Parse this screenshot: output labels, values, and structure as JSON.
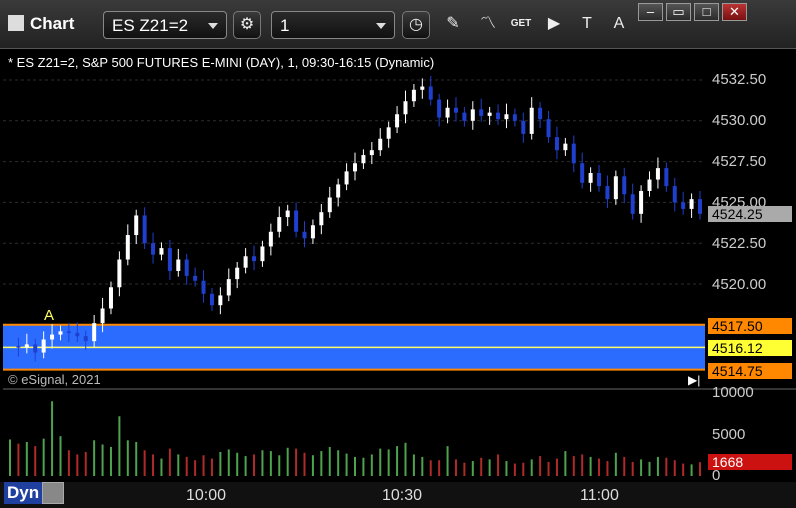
{
  "window": {
    "title": "Chart",
    "symbol_field": "ES Z21=2",
    "interval_field": "1",
    "buttons": [
      "settings-icon",
      "clock-icon",
      "pencil-icon",
      "study-icon",
      "get-icon",
      "play-icon",
      "text-tool-icon",
      "alert-icon"
    ],
    "get_label": "GET",
    "controls": [
      "minimize-icon",
      "restore-icon",
      "maximize-icon",
      "close-icon"
    ]
  },
  "chart": {
    "symbol_info": "* ES Z21=2, S&P 500 FUTURES E-MINI (DAY), 1, 09:30-16:15 (Dynamic)",
    "credit": "© eSignal, 2021",
    "marker_label": "A",
    "mode_label": "Dyn"
  },
  "colors": {
    "up": "#ffffff",
    "down": "#1f3fcf",
    "band": "#2b6cff",
    "band_edge": "#ff8800",
    "mid_line": "#ffff66",
    "vol_up": "#4ea34e",
    "vol_down": "#b02a2a"
  },
  "chart_data": {
    "type": "candlestick",
    "price_axis": {
      "ticks": [
        "4532.50",
        "4530.00",
        "4527.50",
        "4525.00",
        "4522.50",
        "4520.00"
      ]
    },
    "time_axis": {
      "ticks": [
        "10:00",
        "10:30",
        "11:00"
      ]
    },
    "volume_axis": {
      "ticks": [
        "10000",
        "5000",
        "0"
      ]
    },
    "price_tags": {
      "last": "4524.25",
      "band_top": "4517.50",
      "band_mid": "4516.12",
      "band_bottom": "4514.75",
      "volume_last": "1668"
    },
    "price_series": [
      4516.2,
      4516.1,
      4516.3,
      4515.8,
      4516.6,
      4516.9,
      4517.1,
      4517.0,
      4516.8,
      4516.5,
      4517.6,
      4518.5,
      4519.8,
      4521.5,
      4523.0,
      4524.2,
      4522.5,
      4521.8,
      4522.2,
      4520.8,
      4521.5,
      4520.5,
      4520.2,
      4519.4,
      4518.7,
      4519.3,
      4520.3,
      4521.0,
      4521.7,
      4521.4,
      4522.3,
      4523.2,
      4524.1,
      4524.5,
      4523.2,
      4522.8,
      4523.6,
      4524.4,
      4525.3,
      4526.1,
      4526.9,
      4527.4,
      4527.9,
      4528.2,
      4528.9,
      4529.6,
      4530.4,
      4531.2,
      4531.9,
      4532.1,
      4531.3,
      4530.2,
      4530.8,
      4530.5,
      4530.0,
      4530.7,
      4530.3,
      4530.5,
      4530.1,
      4530.4,
      4530.0,
      4529.2,
      4530.8,
      4530.1,
      4529.0,
      4528.2,
      4528.6,
      4527.4,
      4526.2,
      4526.8,
      4526.0,
      4525.2,
      4526.6,
      4525.5,
      4524.3,
      4525.7,
      4526.4,
      4527.1,
      4526.0,
      4525.0,
      4524.6,
      4525.2,
      4524.3
    ],
    "volume_series": [
      4400,
      3900,
      4100,
      3600,
      4500,
      9000,
      4800,
      3100,
      2600,
      2900,
      4300,
      3800,
      3500,
      7200,
      4300,
      4100,
      3100,
      2600,
      2100,
      3300,
      2600,
      2300,
      1900,
      2500,
      2100,
      2900,
      3200,
      2800,
      2400,
      2600,
      3100,
      3000,
      2500,
      3400,
      3300,
      2800,
      2500,
      3000,
      3500,
      3100,
      2700,
      2300,
      2200,
      2600,
      3300,
      3200,
      3600,
      4000,
      2600,
      2300,
      1900,
      1900,
      3600,
      2000,
      1600,
      1800,
      2200,
      2000,
      2600,
      1800,
      1500,
      1600,
      2000,
      2400,
      1700,
      2100,
      3000,
      2400,
      2600,
      2300,
      2100,
      1800,
      2800,
      2300,
      1700,
      2000,
      1700,
      2300,
      2200,
      1900,
      1500,
      1400,
      1668
    ]
  }
}
